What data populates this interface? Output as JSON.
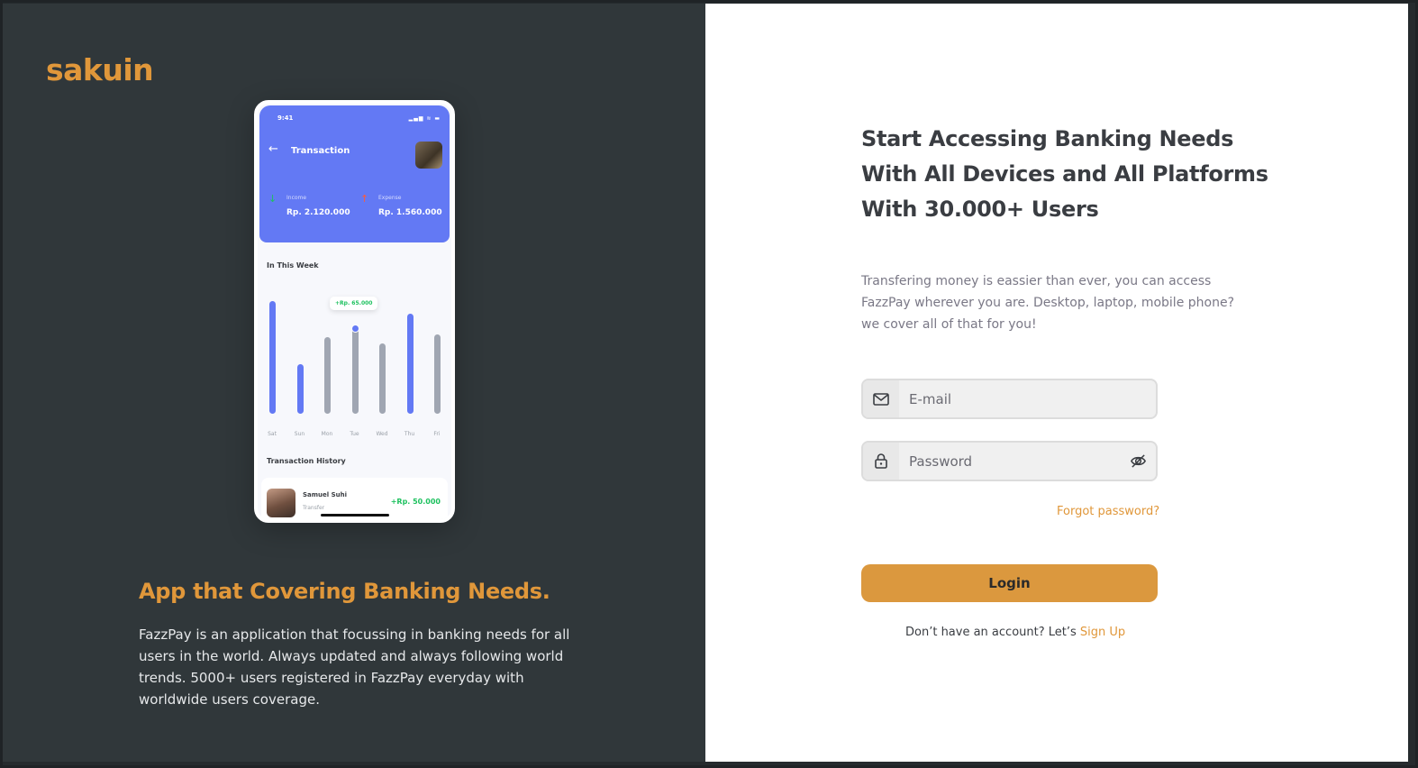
{
  "brand": "sakuin",
  "phone": {
    "status_time": "9:41",
    "status_icons": "▂▄▆ ≋ ▬",
    "screen_title": "Transaction",
    "income_label": "Income",
    "income_value": "Rp. 2.120.000",
    "expense_label": "Expense",
    "expense_value": "Rp. 1.560.000",
    "week_title": "In This Week",
    "bubble_text": "+Rp. 65.000",
    "chart": {
      "days": [
        "Sat",
        "Sun",
        "Mon",
        "Tue",
        "Wed",
        "Thu",
        "Fri"
      ],
      "values": [
        0.96,
        0.42,
        0.65,
        0.72,
        0.6,
        0.85,
        0.68
      ],
      "highlight": [
        true,
        true,
        false,
        false,
        false,
        true,
        false
      ],
      "selected_index": 3,
      "colors": {
        "accent": "#6379f4",
        "muted": "#a0a6b2"
      }
    },
    "history_title": "Transaction History",
    "history": {
      "name": "Samuel Suhi",
      "type": "Transfer",
      "amount": "+Rp. 50.000"
    }
  },
  "tagline": "App that Covering Banking Needs.",
  "description": "FazzPay is an application that focussing in banking needs for all users in the world. Always updated and always following world trends. 5000+ users registered in FazzPay everyday with worldwide users coverage.",
  "login": {
    "headline": "Start Accessing Banking Needs With All Devices and All Platforms With 30.000+ Users",
    "subtext": "Transfering money is eassier than ever, you can access FazzPay wherever you are. Desktop, laptop, mobile phone? we cover all of that for you!",
    "email_placeholder": "E-mail",
    "password_placeholder": "Password",
    "forgot_label": "Forgot password?",
    "login_label": "Login",
    "signup_prompt": "Don’t have an account? Let’s ",
    "signup_link": "Sign Up"
  },
  "colors": {
    "accent": "#e0973a",
    "button": "#db983e",
    "dark_bg": "#30373a"
  }
}
